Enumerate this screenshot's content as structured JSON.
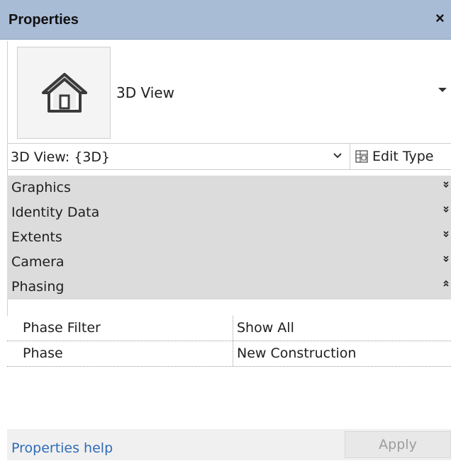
{
  "titlebar": {
    "title": "Properties",
    "close_glyph": "×"
  },
  "type_selector": {
    "icon": "house-icon",
    "name": "3D View"
  },
  "instance_selector": {
    "label": "3D View: {3D}",
    "edit_type_label": "Edit Type",
    "edit_type_icon": "edit-type-icon"
  },
  "groups": [
    {
      "label": "Graphics",
      "state": "collapsed"
    },
    {
      "label": "Identity Data",
      "state": "collapsed"
    },
    {
      "label": "Extents",
      "state": "collapsed"
    },
    {
      "label": "Camera",
      "state": "collapsed"
    },
    {
      "label": "Phasing",
      "state": "expanded"
    }
  ],
  "properties": [
    {
      "name": "Phase Filter",
      "value": "Show All"
    },
    {
      "name": "Phase",
      "value": "New Construction"
    }
  ],
  "footer": {
    "help_link": "Properties help",
    "apply_label": "Apply"
  },
  "colors": {
    "titlebar": "#a9bcd6",
    "group_bg": "#dcdcdc",
    "link": "#2f6bb8",
    "disabled_text": "#9c9c9c"
  }
}
